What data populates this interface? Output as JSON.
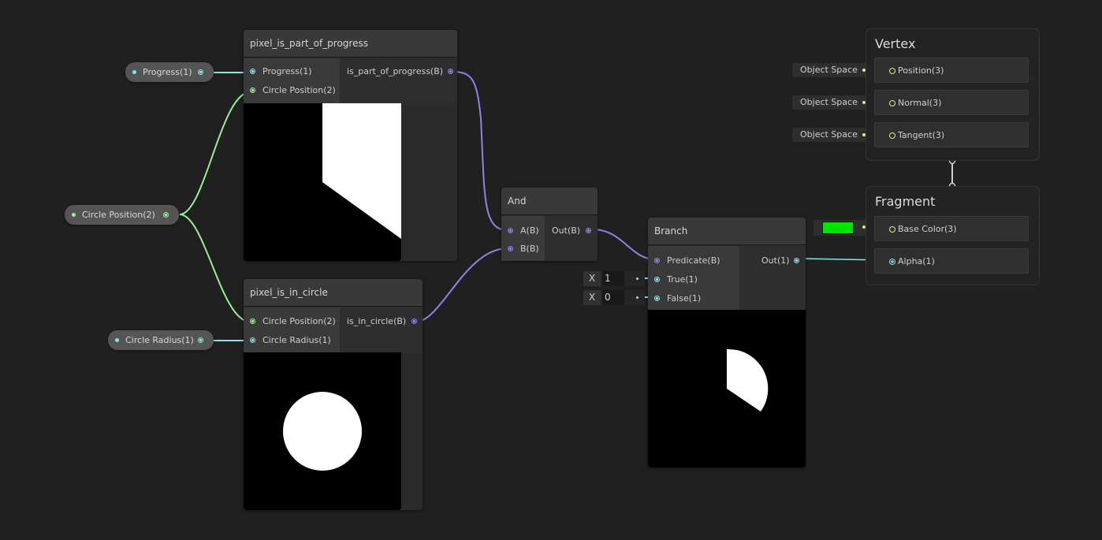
{
  "colors": {
    "float": "#84e4e7",
    "vector2": "#9aef92",
    "boolean": "#9481e6",
    "vector3": "#f6ff9a",
    "base_color": "#00e400"
  },
  "properties": {
    "progress": "Progress(1)",
    "circle_position": "Circle Position(2)",
    "circle_radius": "Circle Radius(1)"
  },
  "nodes": {
    "progress": {
      "title": "pixel_is_part_of_progress",
      "inputs": [
        "Progress(1)",
        "Circle Position(2)"
      ],
      "output": "is_part_of_progress(B)"
    },
    "circle": {
      "title": "pixel_is_in_circle",
      "inputs": [
        "Circle Position(2)",
        "Circle Radius(1)"
      ],
      "output": "is_in_circle(B)"
    },
    "and": {
      "title": "And",
      "inputs": [
        "A(B)",
        "B(B)"
      ],
      "output": "Out(B)"
    },
    "branch": {
      "title": "Branch",
      "inputs": [
        "Predicate(B)",
        "True(1)",
        "False(1)"
      ],
      "output": "Out(1)",
      "true_axis": "X",
      "true_value": "1",
      "false_axis": "X",
      "false_value": "0"
    }
  },
  "master": {
    "vertex": {
      "title": "Vertex",
      "space": "Object Space",
      "blocks": [
        "Position(3)",
        "Normal(3)",
        "Tangent(3)"
      ]
    },
    "fragment": {
      "title": "Fragment",
      "blocks": [
        "Base Color(3)",
        "Alpha(1)"
      ]
    }
  }
}
